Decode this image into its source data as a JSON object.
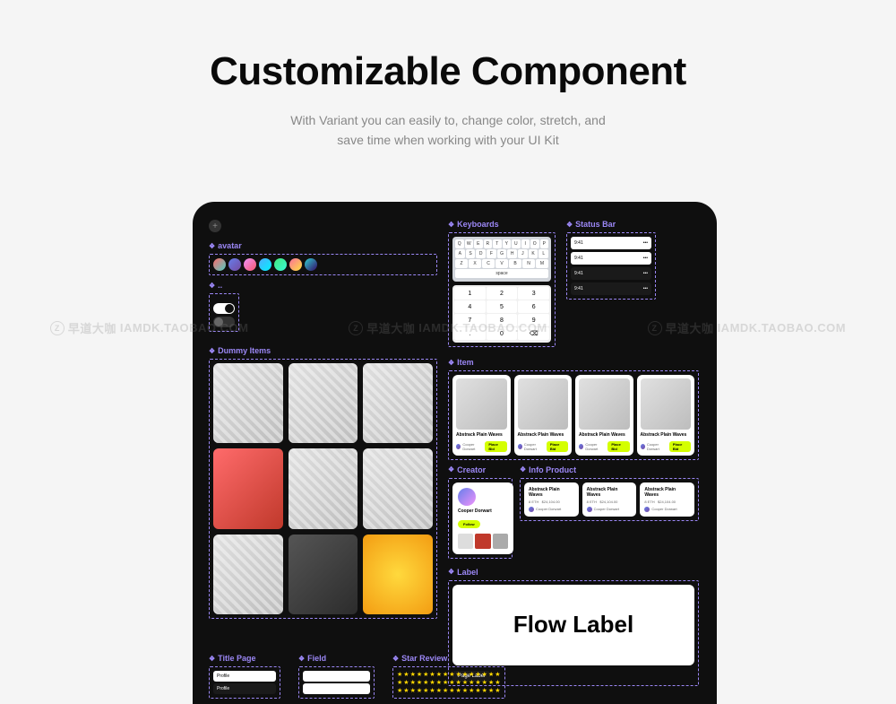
{
  "hero": {
    "title": "Customizable Component",
    "subtitle_l1": "With Variant you can easily to, change color, stretch, and",
    "subtitle_l2": "save time when working with your UI Kit"
  },
  "sections": {
    "avatar": "avatar",
    "dummy": "Dummy Items",
    "keyboards": "Keyboards",
    "status_bar": "Status Bar",
    "item": "Item",
    "creator": "Creator",
    "info_product": "Info Product",
    "label": "Label",
    "title_page": "Title Page",
    "field": "Field",
    "star_review": "Star Review"
  },
  "keyboard": {
    "rows": [
      [
        "Q",
        "W",
        "E",
        "R",
        "T",
        "Y",
        "U",
        "I",
        "O",
        "P"
      ],
      [
        "A",
        "S",
        "D",
        "F",
        "G",
        "H",
        "J",
        "K",
        "L"
      ],
      [
        "Z",
        "X",
        "C",
        "V",
        "B",
        "N",
        "M"
      ]
    ]
  },
  "numpad": {
    "rows": [
      [
        "1",
        "2",
        "3"
      ],
      [
        "4",
        "5",
        "6"
      ],
      [
        "7",
        "8",
        "9"
      ],
      [
        ".",
        "0",
        "⌫"
      ]
    ]
  },
  "item_card": {
    "title": "Abstrack Plain Waves",
    "creator": "Cooper Dorwart",
    "bid": "Place Bid"
  },
  "creator": {
    "name": "Cooper Dorwart",
    "follow": "Follow"
  },
  "info_product": {
    "title": "Abstrack Plain Waves",
    "price_eth": "8 ETH",
    "price_usd": "$24,104.00"
  },
  "label": {
    "main": "Flow Label",
    "page": "Page Label"
  },
  "title_page": {
    "items": [
      "Profile",
      "Profile"
    ]
  },
  "watermark": {
    "cn": "早道大咖",
    "url": "IAMDK.TAOBAO.COM",
    "z": "Z"
  }
}
